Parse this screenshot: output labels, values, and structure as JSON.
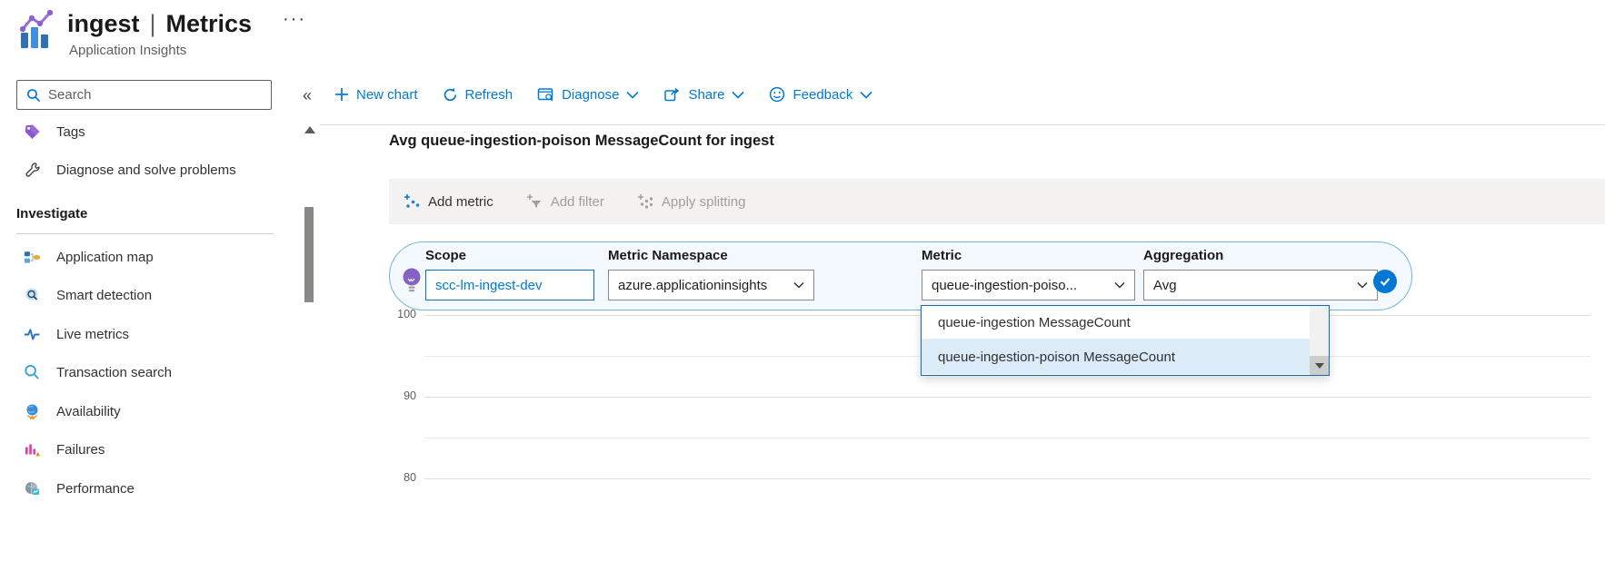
{
  "header": {
    "resource_name": "ingest",
    "separator": "|",
    "page_name": "Metrics",
    "subtitle": "Application Insights",
    "more_label": "···"
  },
  "sidebar": {
    "search_placeholder": "Search",
    "items_top": [
      {
        "label": "Tags"
      },
      {
        "label": "Diagnose and solve problems"
      }
    ],
    "investigate": {
      "title": "Investigate",
      "items": [
        {
          "label": "Application map"
        },
        {
          "label": "Smart detection"
        },
        {
          "label": "Live metrics"
        },
        {
          "label": "Transaction search"
        },
        {
          "label": "Availability"
        },
        {
          "label": "Failures"
        },
        {
          "label": "Performance"
        }
      ]
    }
  },
  "command_bar": {
    "collapse_label": "«",
    "buttons": [
      {
        "label": "New chart"
      },
      {
        "label": "Refresh"
      },
      {
        "label": "Diagnose"
      },
      {
        "label": "Share"
      },
      {
        "label": "Feedback"
      }
    ]
  },
  "chart": {
    "title": "Avg queue-ingestion-poison MessageCount for ingest"
  },
  "metric_actions": {
    "add_metric": "Add metric",
    "add_filter": "Add filter",
    "apply_splitting": "Apply splitting"
  },
  "metric_picker": {
    "scope_label": "Scope",
    "scope_value": "scc-lm-ingest-dev",
    "namespace_label": "Metric Namespace",
    "namespace_value": "azure.applicationinsights",
    "metric_label": "Metric",
    "metric_value": "queue-ingestion-poiso...",
    "aggregation_label": "Aggregation",
    "aggregation_value": "Avg"
  },
  "metric_dropdown": {
    "options": [
      {
        "label": "queue-ingestion MessageCount",
        "selected": false
      },
      {
        "label": "queue-ingestion-poison MessageCount",
        "selected": true
      }
    ]
  },
  "chart_data": {
    "type": "line",
    "title": "Avg queue-ingestion-poison MessageCount for ingest",
    "y_tick_labels": [
      "100",
      "90",
      "80"
    ],
    "grid": true,
    "series": []
  }
}
